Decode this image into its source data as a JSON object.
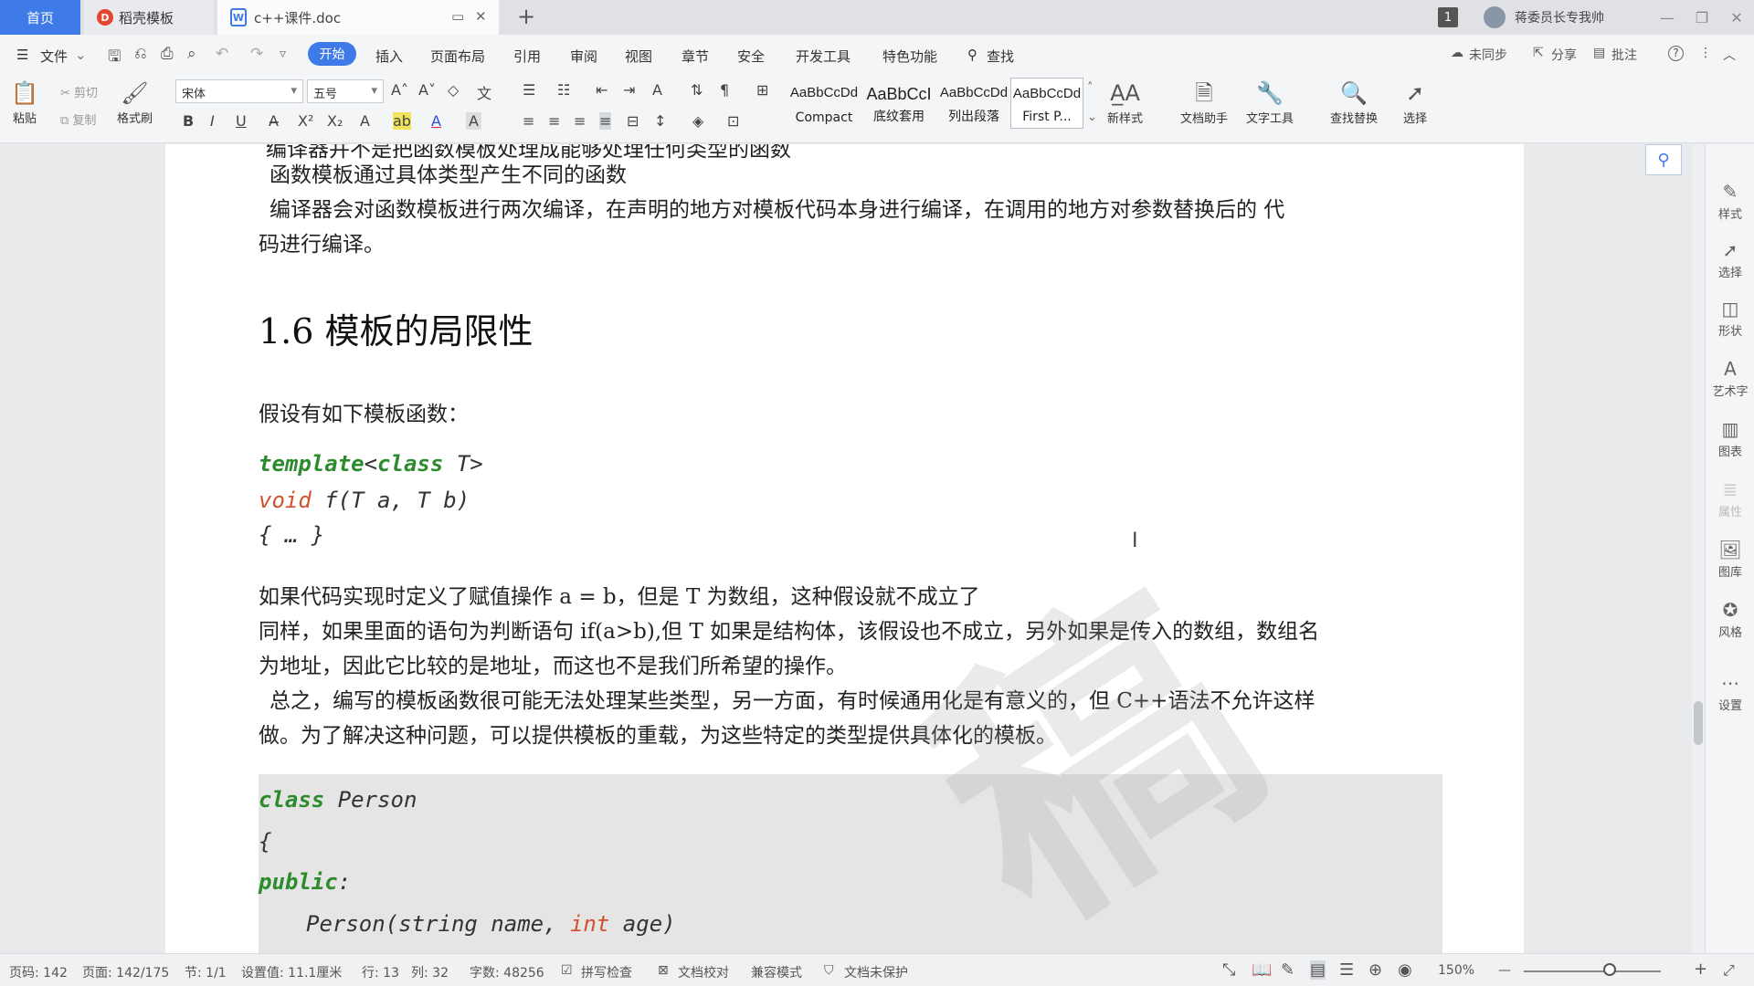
{
  "tabs": {
    "home": "首页",
    "docer": "稻壳模板",
    "docer_logo": "D",
    "doc": "c++课件.doc",
    "doc_logo": "W",
    "doc_icon": "monitor-icon",
    "close": "✕",
    "add": "+"
  },
  "window": {
    "badge": "1",
    "user": "蒋委员长专我帅",
    "minimize": "—",
    "restore": "❐",
    "close": "✕"
  },
  "menu": {
    "hamburger": "☰",
    "file": "文件",
    "start": "开始",
    "items": [
      "插入",
      "页面布局",
      "引用",
      "审阅",
      "视图",
      "章节",
      "安全",
      "开发工具",
      "特色功能"
    ],
    "search": "查找",
    "sync": "未同步",
    "share": "分享",
    "comment": "批注",
    "help": "?",
    "more": "⋮",
    "collapse": "︿"
  },
  "ribbon": {
    "paste": "粘贴",
    "cut": "剪切",
    "copy": "复制",
    "format_painter": "格式刷",
    "font_name": "宋体",
    "font_size": "五号",
    "styles": [
      {
        "preview": "AaBbCcDd",
        "name": "Compact"
      },
      {
        "preview": "AaBbCcI",
        "name": "底纹套用"
      },
      {
        "preview": "AaBbCcDd",
        "name": "列出段落"
      },
      {
        "preview": "AaBbCcDd",
        "name": "First P..."
      }
    ],
    "new_style": "新样式",
    "doc_assistant": "文档助手",
    "text_tools": "文字工具",
    "find_replace": "查找替换",
    "select": "选择"
  },
  "document": {
    "line_top_cut": "编译器并不是把函数模板处理成能够处理任何类型的函数",
    "line1": "函数模板通过具体类型产生不同的函数",
    "line2a": "编译器会对函数模板进行两次编译，在声明的地方对模板代码本身进行编译，在调用的地方对参数替换后的 代",
    "line2b": "码进行编译。",
    "heading": "1.6 模板的局限性",
    "intro": "假设有如下模板函数：",
    "code1": {
      "kw_template": "template",
      "lt": "<",
      "kw_class": "class",
      "t_close": " T>",
      "kw_void": "void",
      "sig": " f(T a, T b)",
      "body": "{ … }"
    },
    "p1": "如果代码实现时定义了赋值操作 a = b，但是 T 为数组，这种假设就不成立了",
    "p2a": "同样，如果里面的语句为判断语句 if(a>b),但 T 如果是结构体，该假设也不成立，另外如果是传入的数组，数组名",
    "p2b": "为地址，因此它比较的是地址，而这也不是我们所希望的操作。",
    "p3a": "总之，编写的模板函数很可能无法处理某些类型，另一方面，有时候通用化是有意义的，但 C++语法不允许这样",
    "p3b": "做。为了解决这种问题，可以提供模板的重载，为这些特定的类型提供具体化的模板。",
    "code2": {
      "kw_class": "class",
      "class_name": " Person",
      "open": "{",
      "kw_public": "public",
      "colon": ":",
      "ctor": "Person(string name, ",
      "kw_int": "int",
      "ctor_end": " age)"
    },
    "watermark": "稿",
    "cursor": "I"
  },
  "side_panel": [
    "样式",
    "选择",
    "形状",
    "艺术字",
    "图表",
    "属性",
    "图库",
    "风格",
    "设置"
  ],
  "status": {
    "page_code": "页码: 142",
    "page": "页面: 142/175",
    "section": "节: 1/1",
    "setting": "设置值: 11.1厘米",
    "row": "行: 13",
    "col": "列: 32",
    "words": "字数: 48256",
    "spell": "拼写检查",
    "proof": "文档校对",
    "compat": "兼容模式",
    "protect": "文档未保护",
    "zoom": "150%",
    "zoom_out": "—",
    "zoom_in": "+",
    "fullscreen": "⤢"
  },
  "colors": {
    "accent": "#3e7be8",
    "keyword_green": "#2c8b2c",
    "keyword_orange": "#d0512c",
    "code_bg": "#e5e5e5"
  }
}
